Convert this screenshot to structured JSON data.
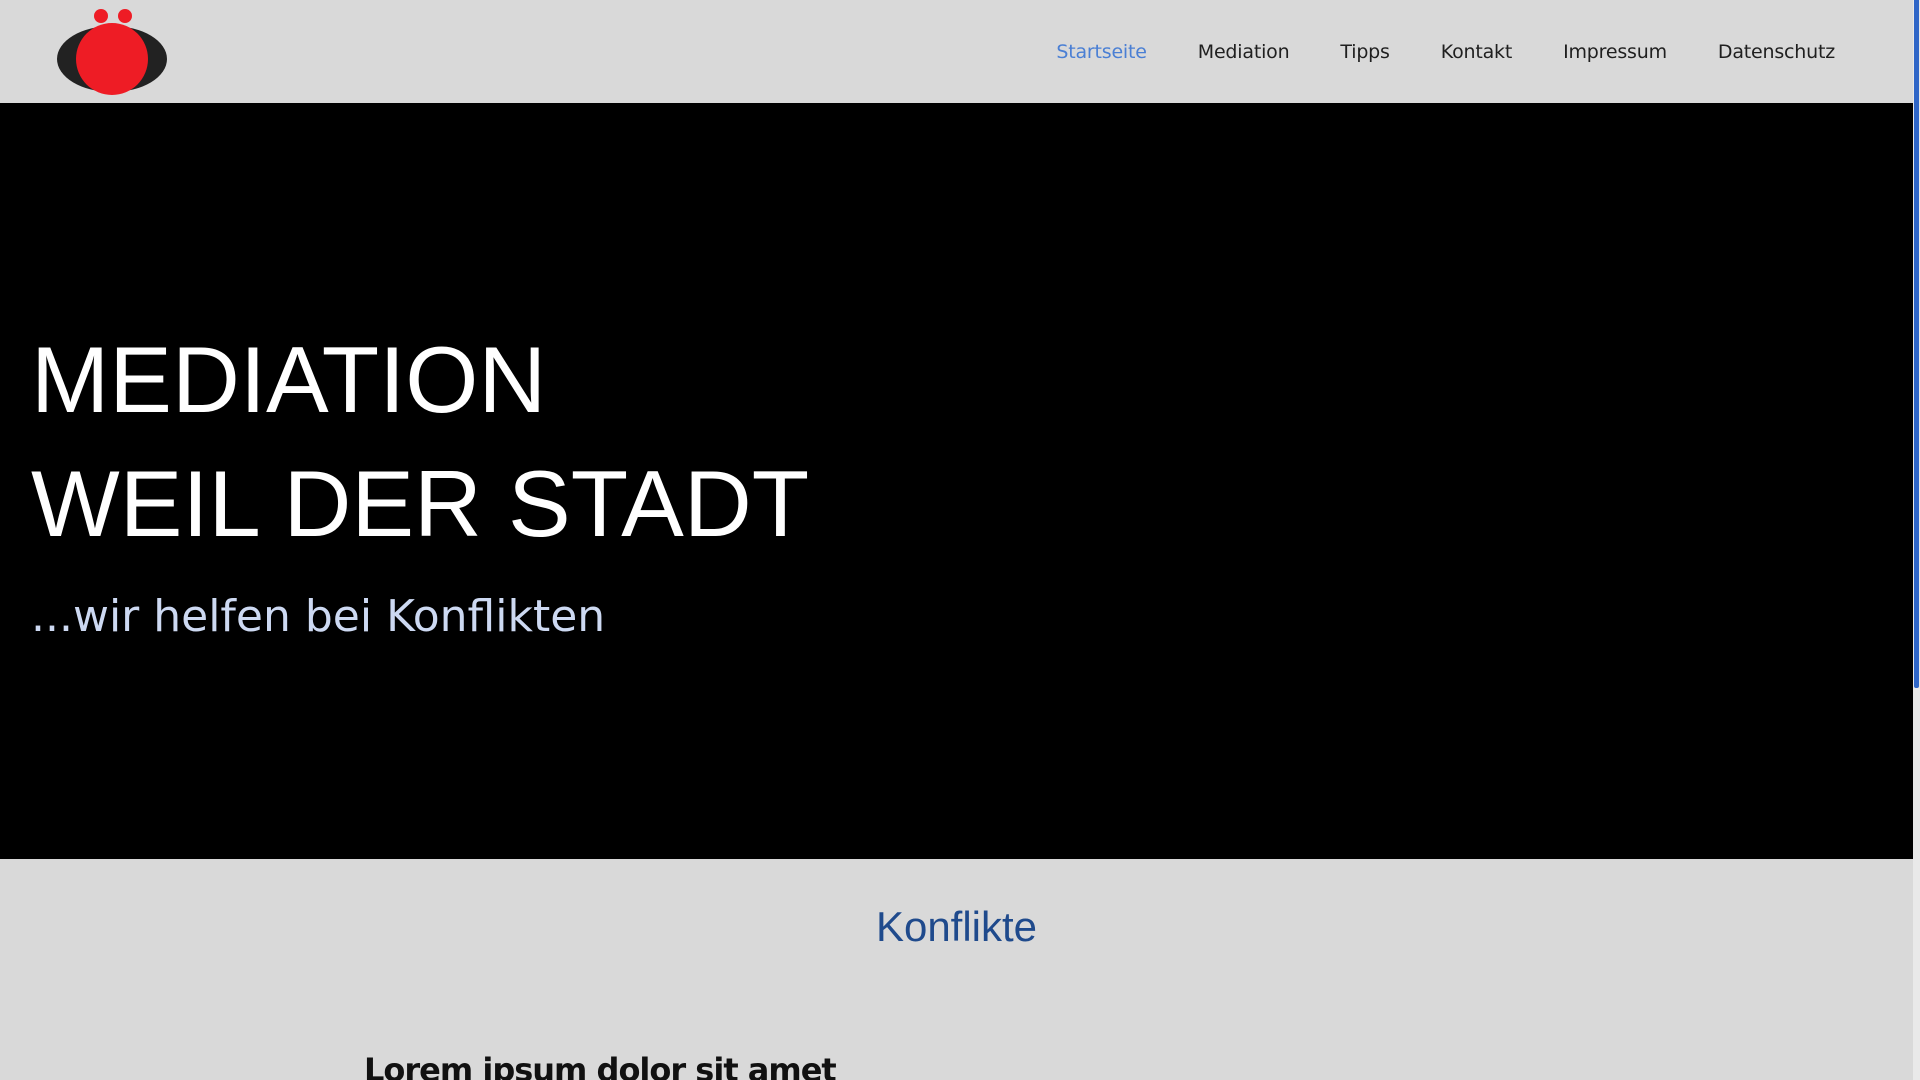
{
  "nav": {
    "items": [
      {
        "label": "Startseite",
        "active": true
      },
      {
        "label": "Mediation",
        "active": false
      },
      {
        "label": "Tipps",
        "active": false
      },
      {
        "label": "Kontakt",
        "active": false
      },
      {
        "label": "Impressum",
        "active": false
      },
      {
        "label": "Datenschutz",
        "active": false
      }
    ]
  },
  "hero": {
    "title_line1": "MEDIATION",
    "title_line2": "WEIL DER STADT",
    "subtitle": "...wir helfen bei Konflikten"
  },
  "section": {
    "title": "Konflikte",
    "lead": "Lorem ipsum dolor sit amet"
  },
  "colors": {
    "header_bg": "#d9d9d9",
    "hero_bg": "#000000",
    "nav_active": "#4a7fd4",
    "logo_red": "#ee1c25",
    "logo_dark": "#222222",
    "section_title": "#1f4a8c",
    "scroll_thumb": "#2f66c7"
  },
  "icons": {
    "logo": "logo-icon"
  }
}
